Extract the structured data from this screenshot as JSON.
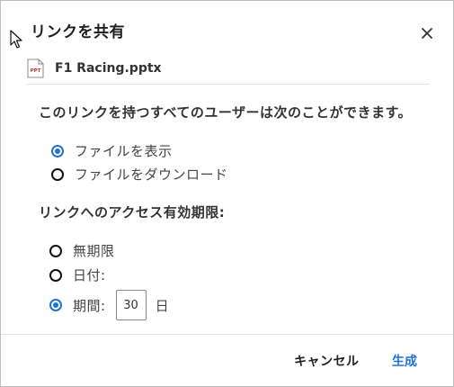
{
  "dialog": {
    "title": "リンクを共有",
    "close_icon": "close-icon"
  },
  "file": {
    "icon": "pptx-file-icon",
    "icon_text": "PPT",
    "name": "F1 Racing.pptx"
  },
  "permissions": {
    "label": "このリンクを持つすべてのユーザーは次のことができます。",
    "options": [
      {
        "label": "ファイルを表示",
        "checked": true
      },
      {
        "label": "ファイルをダウンロード",
        "checked": false
      }
    ]
  },
  "expiration": {
    "label": "リンクへのアクセス有効期限:",
    "options": [
      {
        "label": "無期限",
        "checked": false
      },
      {
        "label": "日付:",
        "checked": false
      },
      {
        "label": "期間:",
        "checked": true
      }
    ],
    "period_value": "30",
    "period_unit": "日"
  },
  "footer": {
    "cancel_label": "キャンセル",
    "create_label": "生成"
  },
  "colors": {
    "accent": "#1f73d8",
    "icon_red": "#c0392b"
  }
}
